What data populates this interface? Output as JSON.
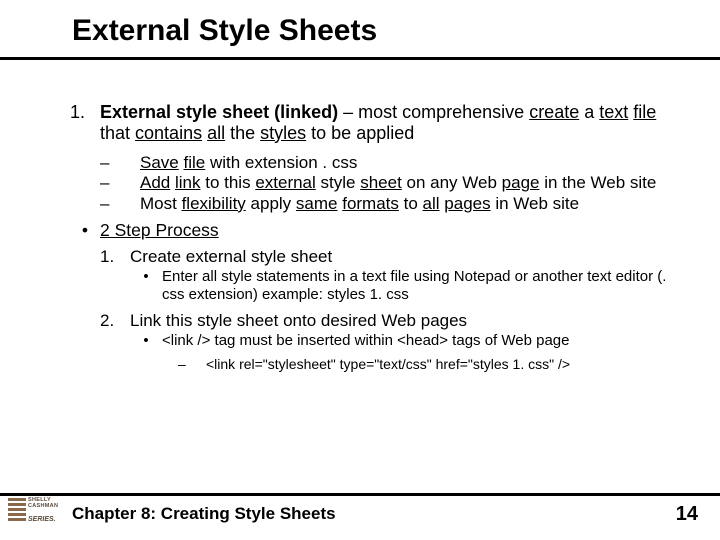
{
  "title": "External Style Sheets",
  "list": {
    "item1_num": "1.",
    "item1_html": "<span class='b'>External style sheet (linked)</span> –  most comprehensive <span class='u'>create</span> a <span class='u'>text</span> <span class='u'>file</span> that <span class='u'>contains</span> <span class='u'>all</span> the <span class='u'>styles</span> to be applied",
    "sub1": [
      "<span class='u'>Save</span> <span class='u'>file</span> with extension . css",
      "<span class='u'>Add</span> <span class='u'>link</span> to this <span class='u'>external</span> style <span class='u'>sheet</span> on any Web <span class='u'>page</span> in the Web site",
      "Most <span class='u'>flexibility</span> apply <span class='u'>same</span> <span class='u'>formats</span> to <span class='u'>all</span> <span class='u'>pages</span> in Web site"
    ],
    "item2_bullet": "•",
    "item2_html": "<span class='u'>2 Step Process</span>",
    "step1_num": "1.",
    "step1_text": "Create external style sheet",
    "step1_sub_bullet": "•",
    "step1_sub_text": "Enter all style statements in a text file using Notepad or another text editor (. css extension) example: styles 1. css",
    "step2_num": "2.",
    "step2_text": "Link this style sheet onto desired Web pages",
    "step2_sub_bullet": "•",
    "step2_sub_text": "<link /> tag must be inserted within <head> tags of Web page",
    "step2_code_dash": "–",
    "step2_code": "<link rel=\"stylesheet\" type=\"text/css\" href=\"styles 1. css\" />"
  },
  "footer": "Chapter 8: Creating Style Sheets",
  "page": "14",
  "logo": {
    "line1": "SHELLY",
    "line2": "CASHMAN",
    "series": "SERIES."
  },
  "dash": "–"
}
